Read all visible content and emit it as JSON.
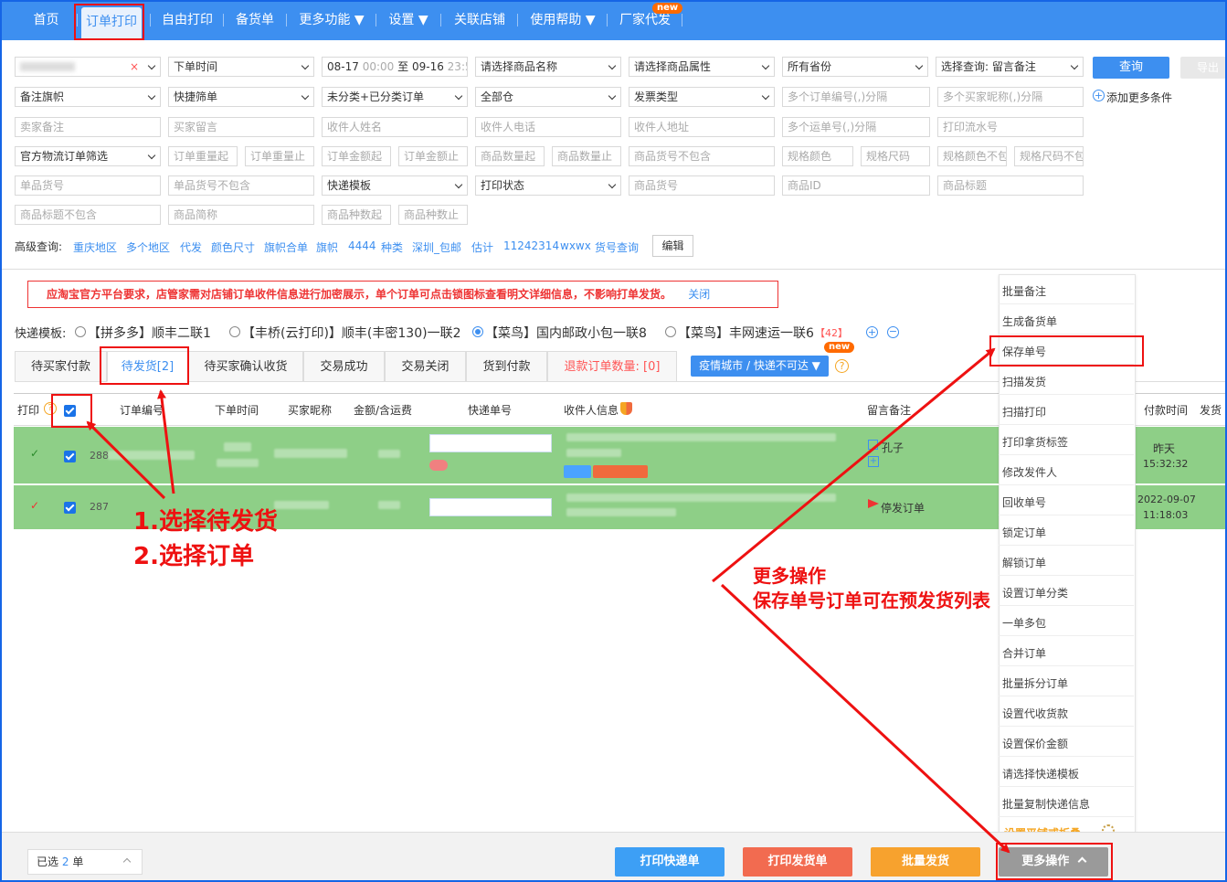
{
  "nav": {
    "items": [
      "首页",
      "订单打印",
      "自由打印",
      "备货单",
      "更多功能 ▼",
      "设置 ▼",
      "关联店铺",
      "使用帮助 ▼",
      "厂家代发"
    ],
    "new_badge": "new"
  },
  "filters": {
    "row1": {
      "shop_value": "",
      "order_time": "下单时间",
      "date_start": "08-17",
      "date_start_time": "00:00",
      "date_to": "至",
      "date_end": "09-16",
      "date_end_time": "23:59",
      "product_name": "请选择商品名称",
      "product_attr": "请选择商品属性",
      "province": "所有省份",
      "query_select": "选择查询: 留言备注",
      "query_button": "查询",
      "export_button": "导出"
    },
    "row2": {
      "remark_flag": "备注旗帜",
      "express_filter": "快捷筛单",
      "category": "未分类+已分类订单",
      "all_store": "全部仓",
      "invoice": "发票类型",
      "order_nos": "多个订单编号(,)分隔",
      "buyer_nicks": "多个买家昵称(,)分隔",
      "add_more": "添加更多条件"
    },
    "row3": [
      "卖家备注",
      "买家留言",
      "收件人姓名",
      "收件人电话",
      "收件人地址",
      "多个运单号(,)分隔",
      "打印流水号"
    ],
    "row4": [
      "官方物流订单筛选",
      "订单重量起",
      "订单重量止",
      "订单金额起",
      "订单金额止",
      "商品数量起",
      "商品数量止",
      "商品货号不包含",
      "规格颜色",
      "规格尺码",
      "规格颜色不包",
      "规格尺码不包"
    ],
    "row5": [
      "单品货号",
      "单品货号不包含",
      "快递模板",
      "打印状态",
      "商品货号",
      "商品ID",
      "商品标题"
    ],
    "row6": [
      "商品标题不包含",
      "商品简称",
      "商品种数起",
      "商品种数止"
    ]
  },
  "advanced": {
    "label": "高级查询:",
    "links": [
      "重庆地区",
      "多个地区",
      "代发",
      "颜色尺寸",
      "旗帜合单",
      "旗帜",
      "4444",
      "种类",
      "深圳_包邮",
      "估计",
      "11242314",
      "wxwx",
      "货号查询"
    ],
    "edit": "编辑"
  },
  "notice": {
    "text": "应淘宝官方平台要求，店管家需对店铺订单收件信息进行加密展示，单个订单可点击锁图标查看明文详细信息，不影响打单发货。",
    "close": "关闭"
  },
  "templates": {
    "label": "快递模板:",
    "items": [
      "【拼多多】顺丰二联1",
      "【丰桥(云打印)】顺丰(丰密130)一联2",
      "【菜鸟】国内邮政小包一联8",
      "【菜鸟】丰网速运一联6"
    ],
    "count": "42",
    "selected_index": 2
  },
  "tabs": {
    "items": [
      "待买家付款",
      "待发货[2]",
      "待买家确认收货",
      "交易成功",
      "交易关闭",
      "货到付款"
    ],
    "refund": "退款订单数量: [0]",
    "epidemic": "疫情城市 / 快递不可达 ▼",
    "help": "?"
  },
  "table": {
    "headers": [
      "打印",
      "订单编号",
      "下单时间",
      "买家昵称",
      "金额/含运费",
      "快递单号",
      "收件人信息",
      "留言备注",
      "付款时间",
      "发货"
    ],
    "rows": [
      {
        "check": "✓",
        "order_prefix": "288",
        "remark": "孔子",
        "pay_day": "昨天",
        "pay_time": "15:32:32"
      },
      {
        "check": "✓",
        "order_prefix": "287",
        "remark": "停发订单",
        "pay_day": "2022-09-07",
        "pay_time": "11:18:03"
      }
    ]
  },
  "menu": {
    "items": [
      "批量备注",
      "生成备货单",
      "保存单号",
      "扫描发货",
      "扫描打印",
      "打印拿货标签",
      "修改发件人",
      "回收单号",
      "锁定订单",
      "解锁订单",
      "设置订单分类",
      "一单多包",
      "合并订单",
      "批量拆分订单",
      "设置代收货款",
      "设置保价金额",
      "请选择快递模板",
      "批量复制快递信息"
    ],
    "special": "设置平铺或折叠"
  },
  "bottom": {
    "selected_prefix": "已选",
    "selected_count": "2",
    "selected_suffix": "单",
    "buttons": [
      "打印快递单",
      "打印发货单",
      "批量发货",
      "更多操作"
    ]
  },
  "colors": {
    "primary": "#3d8ff0",
    "row_green": "#8ecf87",
    "annotation_red": "#e11",
    "btn_red": "#f26b50",
    "btn_orange": "#f7a22e",
    "btn_gray": "#9a9a9a"
  },
  "annotations": {
    "step1": "1.选择待发货",
    "step2": "2.选择订单",
    "more_title": "更多操作",
    "more_desc": "保存单号订单可在预发货列表"
  }
}
